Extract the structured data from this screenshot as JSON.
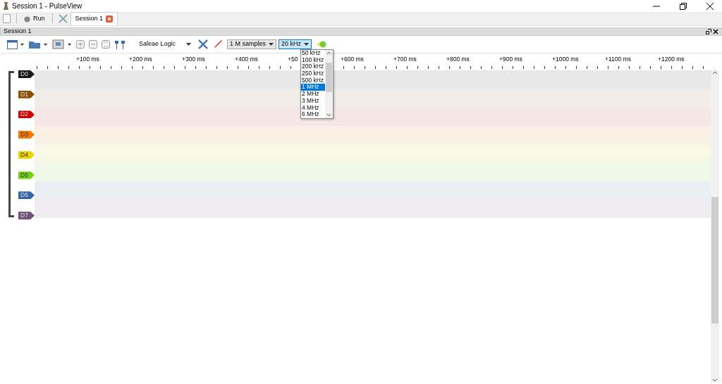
{
  "window": {
    "title": "Session 1 - PulseView"
  },
  "main_toolbar": {
    "run_button": "Run",
    "tabs": [
      {
        "label": "Session 1",
        "selected": true
      }
    ]
  },
  "session": {
    "title": "Session 1",
    "device": "Saleae Logic",
    "samples": "1 M samples",
    "rate": "20 kHz",
    "rate_options": [
      {
        "label": "50 kHz",
        "selected": false
      },
      {
        "label": "100 kHz",
        "selected": false
      },
      {
        "label": "200 kHz",
        "selected": false
      },
      {
        "label": "250 kHz",
        "selected": false
      },
      {
        "label": "500 kHz",
        "selected": false
      },
      {
        "label": "1 MHz",
        "selected": true
      },
      {
        "label": "2 MHz",
        "selected": false
      },
      {
        "label": "3 MHz",
        "selected": false
      },
      {
        "label": "4 MHz",
        "selected": false
      },
      {
        "label": "6 MHz",
        "selected": false
      }
    ],
    "ruler": [
      "+100 ms",
      "+200 ms",
      "+300 ms",
      "+400 ms",
      "+50",
      "+600 ms",
      "+700 ms",
      "+800 ms",
      "+900 ms",
      "+1000 ms",
      "+1100 ms",
      "+1200 ms"
    ],
    "channels": [
      {
        "name": "D0",
        "color": "#1a1a1a"
      },
      {
        "name": "D1",
        "color": "#8f5202"
      },
      {
        "name": "D2",
        "color": "#cc0000"
      },
      {
        "name": "D3",
        "color": "#f57900"
      },
      {
        "name": "D4",
        "color": "#edd400"
      },
      {
        "name": "D5",
        "color": "#73d216"
      },
      {
        "name": "D6",
        "color": "#3465a4"
      },
      {
        "name": "D7",
        "color": "#75507b"
      }
    ]
  }
}
